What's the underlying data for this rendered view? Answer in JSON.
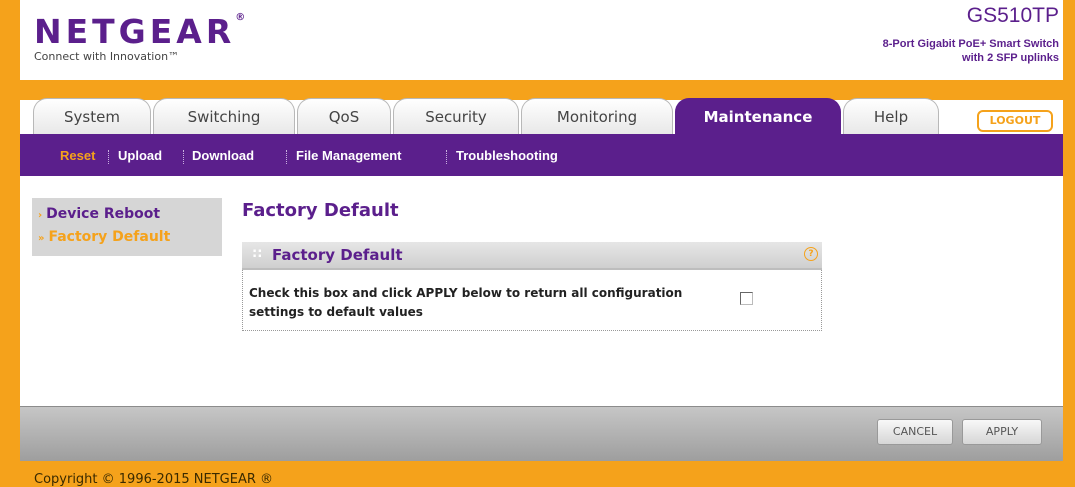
{
  "header": {
    "brand": "NETGEAR",
    "brand_mark": "®",
    "tagline": "Connect with Innovation™",
    "model": "GS510TP",
    "model_desc_line1": "8-Port Gigabit PoE+ Smart Switch",
    "model_desc_line2": "with 2 SFP uplinks"
  },
  "tabs": [
    {
      "label": "System"
    },
    {
      "label": "Switching"
    },
    {
      "label": "QoS"
    },
    {
      "label": "Security"
    },
    {
      "label": "Monitoring"
    },
    {
      "label": "Maintenance",
      "active": true
    },
    {
      "label": "Help"
    }
  ],
  "logout_label": "LOGOUT",
  "subnav": [
    {
      "label": "Reset",
      "active": true
    },
    {
      "label": "Upload"
    },
    {
      "label": "Download"
    },
    {
      "label": "File Management"
    },
    {
      "label": "Troubleshooting"
    }
  ],
  "sidebar": {
    "items": [
      {
        "label": "Device Reboot"
      },
      {
        "label": "Factory Default",
        "active": true
      }
    ]
  },
  "page_title": "Factory Default",
  "panel": {
    "title": "Factory Default",
    "help_icon": "?",
    "text": "Check this box and click APPLY below to return all configuration settings to default values",
    "checkbox_checked": false
  },
  "buttons": {
    "cancel": "CANCEL",
    "apply": "APPLY"
  },
  "footer": {
    "copyright": "Copyright © 1996-2015 NETGEAR ®"
  },
  "colors": {
    "brand_purple": "#5b1f8c",
    "accent_orange": "#f5a21b"
  }
}
